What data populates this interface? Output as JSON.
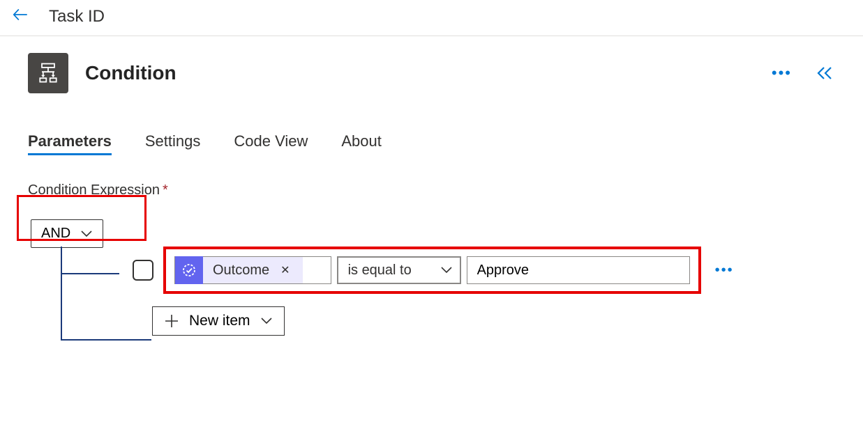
{
  "header": {
    "title": "Task ID"
  },
  "card": {
    "title": "Condition"
  },
  "tabs": [
    {
      "label": "Parameters",
      "active": true
    },
    {
      "label": "Settings",
      "active": false
    },
    {
      "label": "Code View",
      "active": false
    },
    {
      "label": "About",
      "active": false
    }
  ],
  "section": {
    "label": "Condition Expression"
  },
  "condition": {
    "logic": "AND",
    "row": {
      "field_label": "Outcome",
      "operator": "is equal to",
      "value": "Approve"
    },
    "new_item_label": "New item"
  },
  "icons": {
    "condition": "condition-branch",
    "token": "approval-check"
  },
  "colors": {
    "accent": "#0078d4",
    "highlight": "#e60000",
    "token_bg": "#6264ef",
    "token_body": "#eceafd"
  }
}
